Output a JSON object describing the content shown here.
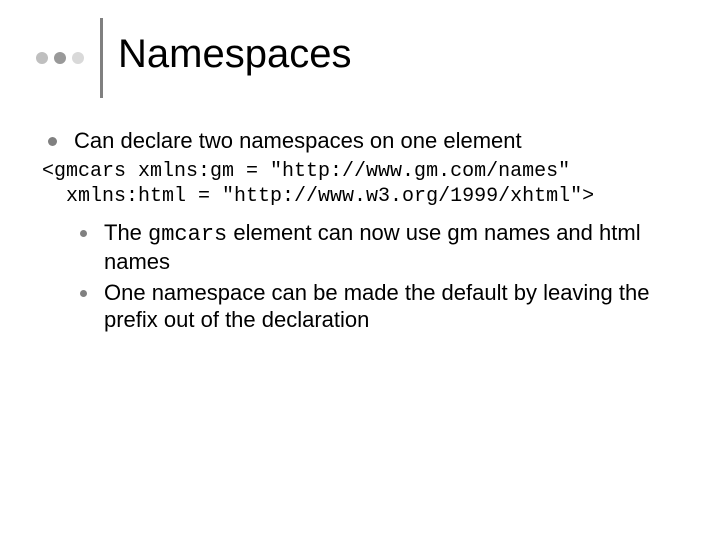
{
  "title": "Namespaces",
  "bullet1": "Can declare two namespaces on one element",
  "code_line1": "<gmcars xmlns:gm = \"http://www.gm.com/names\"",
  "code_line2": "  xmlns:html = \"http://www.w3.org/1999/xhtml\">",
  "sub1_a": "The ",
  "sub1_code": "gmcars",
  "sub1_b": " element can now use gm names and html names",
  "sub2": "One namespace can be made the default by leaving the prefix out of the declaration"
}
